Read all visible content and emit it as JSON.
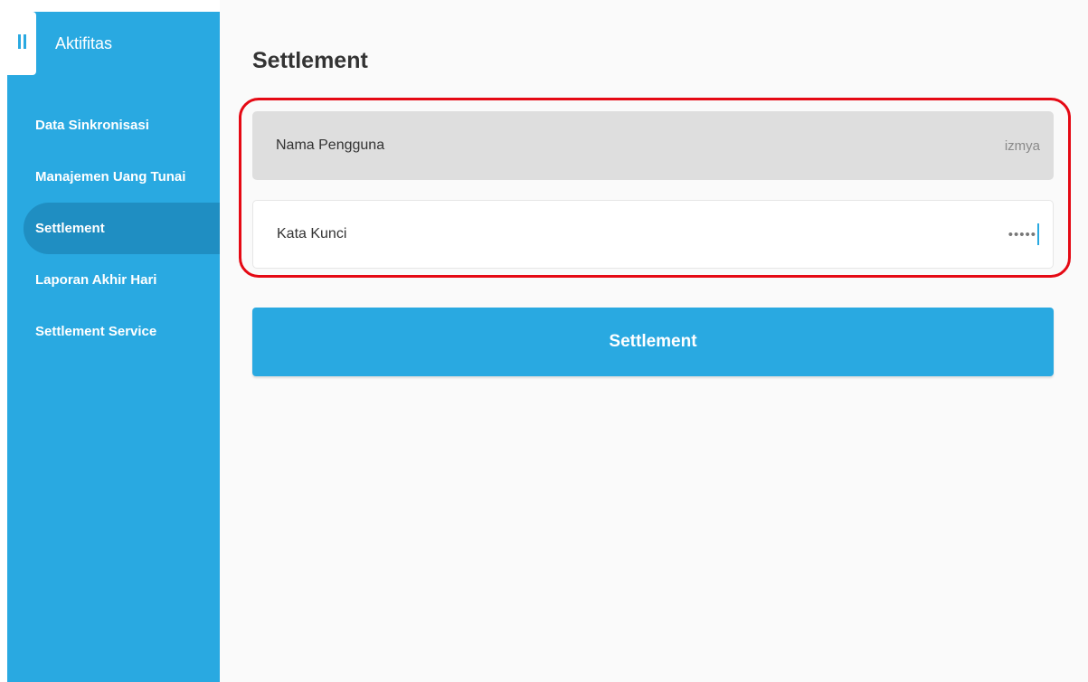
{
  "sidebar": {
    "title": "Aktifitas",
    "items": [
      {
        "label": "Data Sinkronisasi",
        "active": false
      },
      {
        "label": "Manajemen Uang Tunai",
        "active": false
      },
      {
        "label": "Settlement",
        "active": true
      },
      {
        "label": "Laporan Akhir Hari",
        "active": false
      },
      {
        "label": "Settlement Service",
        "active": false
      }
    ]
  },
  "main": {
    "title": "Settlement",
    "form": {
      "username": {
        "label": "Nama Pengguna",
        "value": "izmya"
      },
      "password": {
        "label": "Kata Kunci",
        "masked_value": "•••••"
      }
    },
    "submit_label": "Settlement"
  },
  "colors": {
    "primary": "#29a9e1",
    "sidebar_active": "#1f8ec2",
    "highlight": "#e50914"
  },
  "icons": {
    "menu_toggle": "pause-bars-icon"
  }
}
